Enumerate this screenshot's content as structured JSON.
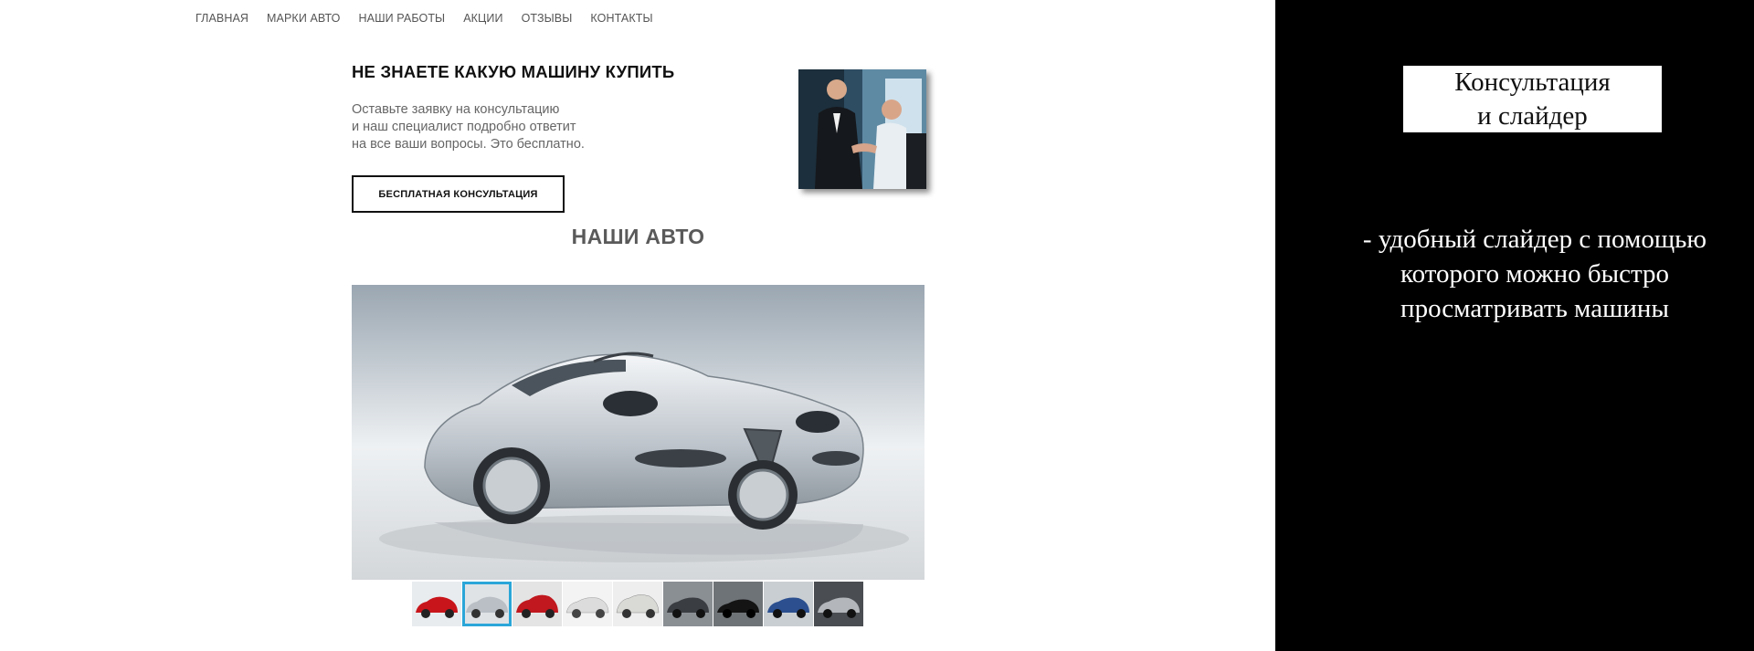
{
  "nav": {
    "items": [
      "ГЛАВНАЯ",
      "МАРКИ АВТО",
      "НАШИ РАБОТЫ",
      "АКЦИИ",
      "ОТЗЫВЫ",
      "КОНТАКТЫ"
    ]
  },
  "consultation": {
    "title": "НЕ ЗНАЕТЕ КАКУЮ МАШИНУ КУПИТЬ",
    "text_lines": [
      "Оставьте заявку на консультацию",
      "и наш специалист подробно ответит",
      "на все ваши вопросы. Это бесплатно."
    ],
    "button_label": "БЕСПЛАТНАЯ КОНСУЛЬТАЦИЯ"
  },
  "cars": {
    "title": "НАШИ АВТО",
    "thumb_colors": [
      "#c8151b",
      "#b9bfc5",
      "#c0181e",
      "#dcdcdc",
      "#d9d9d6",
      "#3a3d42",
      "#141414",
      "#2b4f8f",
      "#5a5c60"
    ],
    "active_thumb": 1
  },
  "caption": {
    "box_lines": [
      "Консультация",
      "и слайдер"
    ],
    "desc_lines": [
      "- удобный  слайдер с помощью",
      "которого можно быстро",
      "просматривать машины"
    ]
  }
}
